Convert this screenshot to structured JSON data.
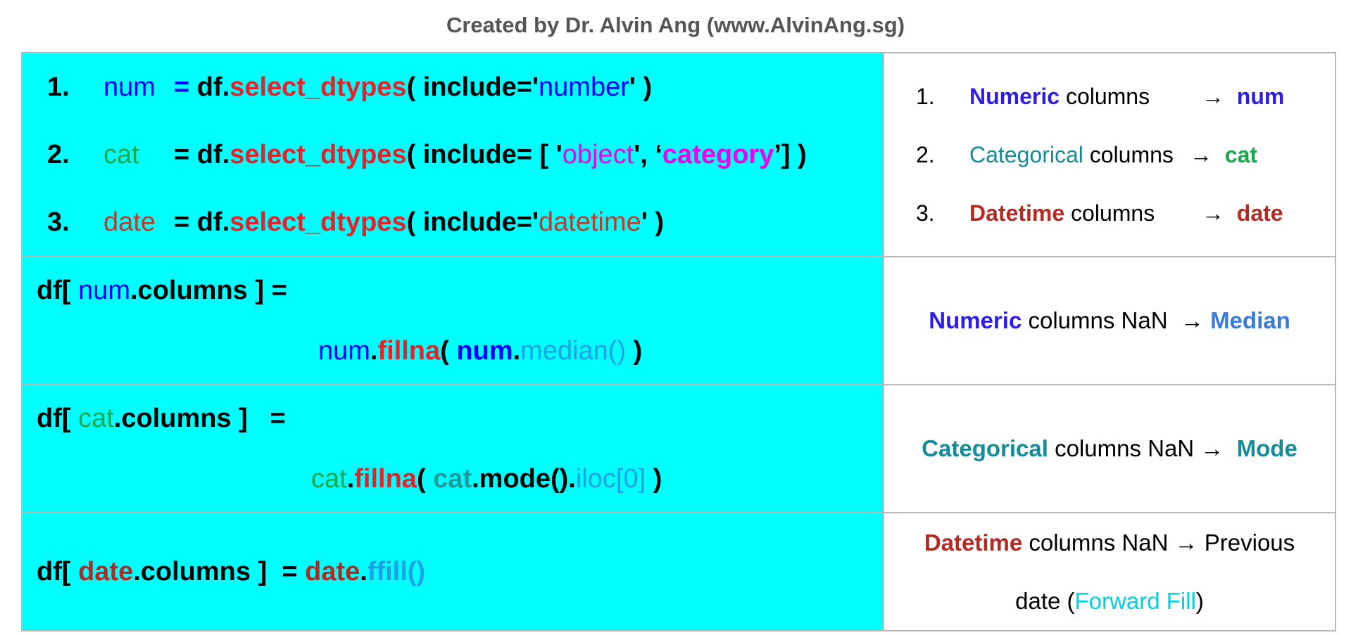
{
  "title": "Created by Dr. Alvin Ang (www.AlvinAng.sg)",
  "rows": {
    "select": {
      "code": [
        {
          "no": "1.",
          "var": "num",
          "eq": "= ",
          "df": "df.",
          "fn": "select_dtypes",
          "open": "( include='",
          "arg": "number",
          "close": "' )"
        },
        {
          "no": "2.",
          "var": "cat",
          "eq": "= ",
          "df": "df.",
          "fn": "select_dtypes",
          "open": "( include= [ '",
          "arg1": "object",
          "sep": "', ‘",
          "arg2": "category",
          "close": "’] )"
        },
        {
          "no": "3.",
          "var": "date",
          "eq": "= ",
          "df": "df.",
          "fn": "select_dtypes",
          "open": "( include='",
          "arg": "datetime",
          "close": "' )"
        }
      ],
      "desc": [
        {
          "no": "1.",
          "kind": "Numeric",
          "word": " columns",
          "arrow": "→  ",
          "target": "num"
        },
        {
          "no": "2.",
          "kind": "Categorical",
          "word": " columns",
          "arrow": "→  ",
          "target": "cat"
        },
        {
          "no": "3.",
          "kind": "Datetime",
          "word": " columns",
          "arrow": "→  ",
          "target": "date"
        }
      ]
    },
    "numeric": {
      "l1_pre": "df[ ",
      "l1_var": "num",
      "l1_post": ".columns ] =",
      "l2_var": "num",
      "l2_dot": ".",
      "l2_fn": "fillna",
      "l2_open": "( ",
      "l2_var2": "num",
      "l2_dot2": ".",
      "l2_m": "median()",
      "l2_close": " )",
      "desc_kind": "Numeric",
      "desc_mid": " columns NaN  → ",
      "desc_target": "Median"
    },
    "categorical": {
      "l1_pre": "df[ ",
      "l1_var": "cat",
      "l1_post": ".columns ]   =",
      "l2_var": "cat",
      "l2_dot": ".",
      "l2_fn": "fillna",
      "l2_open": "( ",
      "l2_var2": "cat",
      "l2_mid": ".mode().",
      "l2_m": "iloc[0]",
      "l2_close": " )",
      "desc_kind": "Categorical",
      "desc_mid": " columns NaN →  ",
      "desc_target": "Mode"
    },
    "datetime": {
      "pre": "df[ ",
      "var": "date",
      "post": ".columns ]  = ",
      "var2": "date",
      "dot": ".",
      "fn": "ffill()",
      "desc_kind": "Datetime",
      "desc_mid": " columns NaN → Previous",
      "desc_l2_pre": "date (",
      "desc_l2_hl": "Forward Fill",
      "desc_l2_post": ")"
    }
  }
}
